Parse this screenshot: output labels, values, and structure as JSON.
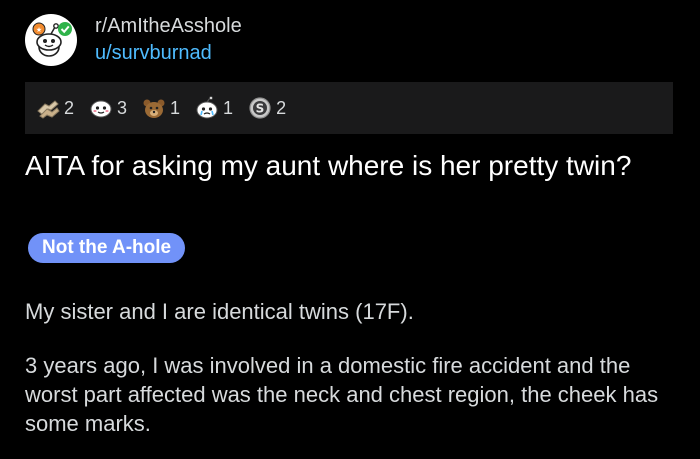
{
  "post": {
    "subreddit": "r/AmItheAsshole",
    "username": "u/survburnad",
    "title": "AITA for asking my aunt where is her pretty twin?",
    "flair": "Not the A-hole",
    "paragraphs": [
      "My sister and I are identical twins (17F).",
      "3 years ago, I was involved in a domestic fire accident and the worst part affected was the neck and chest region, the cheek has some marks."
    ]
  },
  "awards": [
    {
      "icon": "helping-hand-award-icon",
      "count": "2"
    },
    {
      "icon": "wholesome-award-icon",
      "count": "3"
    },
    {
      "icon": "bear-award-icon",
      "count": "1"
    },
    {
      "icon": "snoo-tears-award-icon",
      "count": "1"
    },
    {
      "icon": "silver-award-icon",
      "count": "2"
    }
  ],
  "colors": {
    "background": "#000000",
    "username": "#4fbcff",
    "flair_bg": "#7192f8",
    "awards_bar_bg": "#1a1a1b"
  }
}
